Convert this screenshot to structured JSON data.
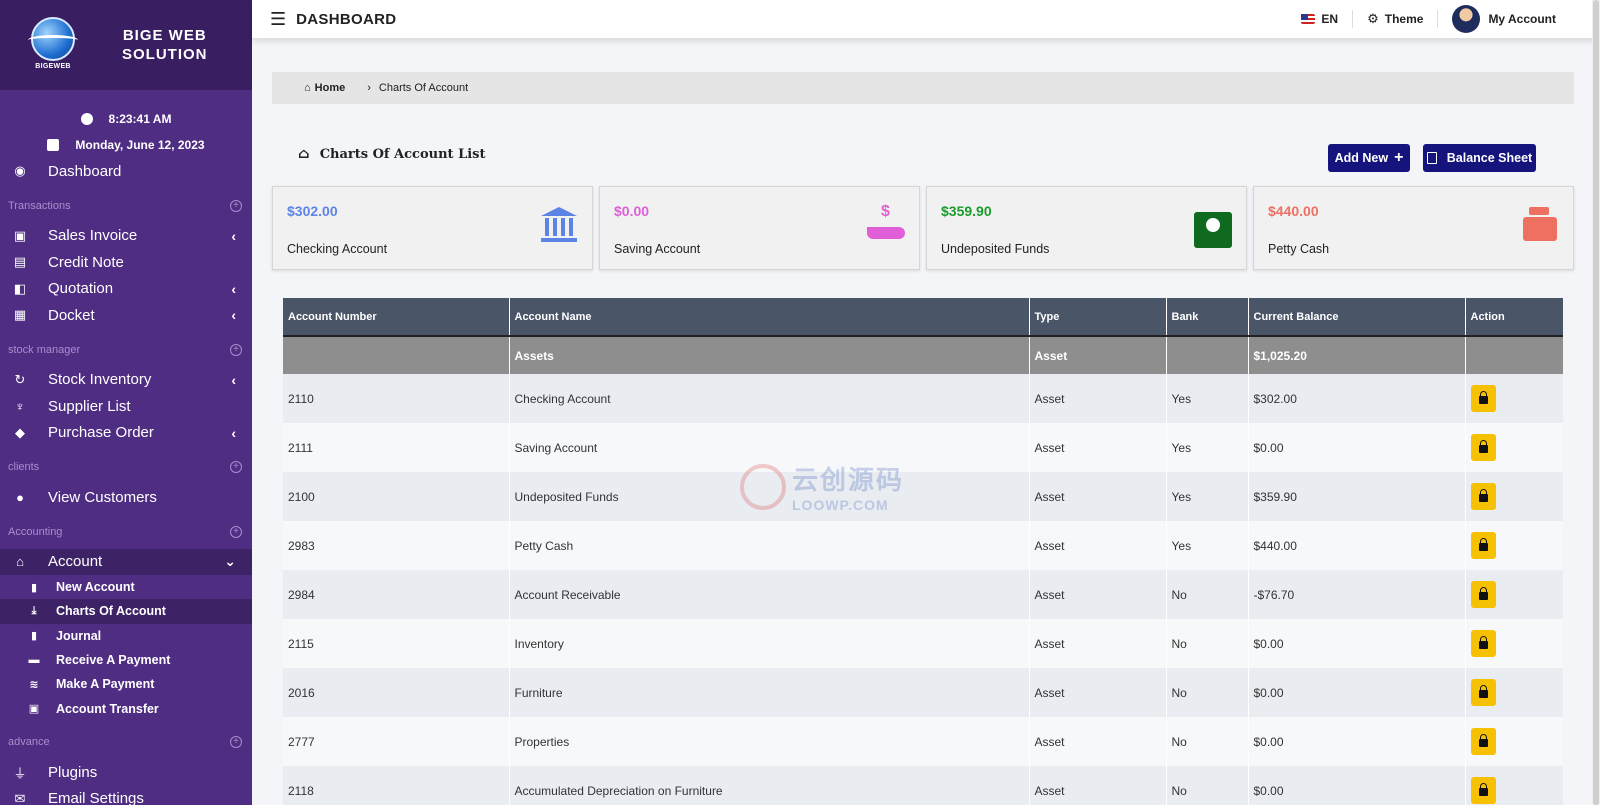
{
  "brand": {
    "name_line1": "BIGE WEB",
    "name_line2": "SOLUTION",
    "logo_text": "BIGEWEB"
  },
  "clock": {
    "time": "8:23:41 AM",
    "date": "Monday, June 12, 2023"
  },
  "sidebar": {
    "dashboard": "Dashboard",
    "sections": {
      "transactions": "Transactions",
      "stock": "stock manager",
      "clients": "clients",
      "accounting": "Accounting",
      "advance": "advance"
    },
    "items": {
      "sales_invoice": "Sales Invoice",
      "credit_note": "Credit Note",
      "quotation": "Quotation",
      "docket": "Docket",
      "stock_inventory": "Stock Inventory",
      "supplier_list": "Supplier List",
      "purchase_order": "Purchase Order",
      "view_customers": "View Customers",
      "account": "Account",
      "plugins": "Plugins",
      "email_settings": "Email Settings"
    },
    "account_sub": {
      "new_account": "New Account",
      "charts_of_account": "Charts Of Account",
      "journal": "Journal",
      "receive_payment": "Receive A Payment",
      "make_payment": "Make A Payment",
      "account_transfer": "Account Transfer"
    }
  },
  "header": {
    "title": "DASHBOARD",
    "lang": "EN",
    "theme": "Theme",
    "account": "My Account"
  },
  "breadcrumb": {
    "home": "Home",
    "current": "Charts Of Account"
  },
  "page": {
    "title": "Charts Of Account List",
    "add_new": "Add New",
    "balance_sheet": "Balance Sheet"
  },
  "cards": [
    {
      "amount": "$302.00",
      "label": "Checking Account",
      "color": "#5b84e6"
    },
    {
      "amount": "$0.00",
      "label": "Saving Account",
      "color": "#e05fd8"
    },
    {
      "amount": "$359.90",
      "label": "Undeposited Funds",
      "color": "#1a9c2a"
    },
    {
      "amount": "$440.00",
      "label": "Petty Cash",
      "color": "#ee7060"
    }
  ],
  "table": {
    "headers": [
      "Account Number",
      "Account Name",
      "Type",
      "Bank",
      "Current Balance",
      "Action"
    ],
    "group": {
      "name": "Assets",
      "type": "Asset",
      "balance": "$1,025.20"
    },
    "rows": [
      {
        "number": "2110",
        "name": "Checking Account",
        "type": "Asset",
        "bank": "Yes",
        "balance": "$302.00"
      },
      {
        "number": "2111",
        "name": "Saving Account",
        "type": "Asset",
        "bank": "Yes",
        "balance": "$0.00"
      },
      {
        "number": "2100",
        "name": "Undeposited Funds",
        "type": "Asset",
        "bank": "Yes",
        "balance": "$359.90"
      },
      {
        "number": "2983",
        "name": "Petty Cash",
        "type": "Asset",
        "bank": "Yes",
        "balance": "$440.00"
      },
      {
        "number": "2984",
        "name": "Account Receivable",
        "type": "Asset",
        "bank": "No",
        "balance": "-$76.70"
      },
      {
        "number": "2115",
        "name": "Inventory",
        "type": "Asset",
        "bank": "No",
        "balance": "$0.00"
      },
      {
        "number": "2016",
        "name": "Furniture",
        "type": "Asset",
        "bank": "No",
        "balance": "$0.00"
      },
      {
        "number": "2777",
        "name": "Properties",
        "type": "Asset",
        "bank": "No",
        "balance": "$0.00"
      },
      {
        "number": "2118",
        "name": "Accumulated Depreciation on Furniture",
        "type": "Asset",
        "bank": "No",
        "balance": "$0.00"
      }
    ]
  },
  "watermark": {
    "line1": "云创源码",
    "line2": "LOOWP.COM"
  }
}
